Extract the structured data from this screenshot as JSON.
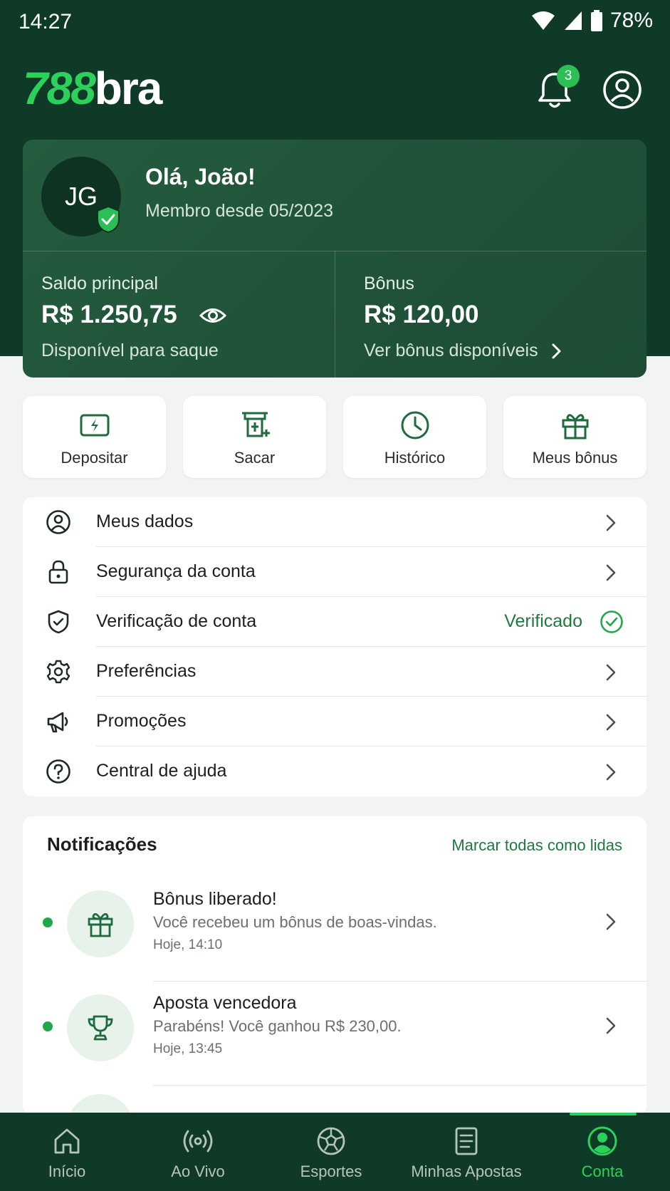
{
  "status_bar": {
    "time": "14:27",
    "battery": "78%"
  },
  "app_bar": {
    "logo_number": "788",
    "logo_text": "bra",
    "notification_count": "3"
  },
  "account": {
    "initials": "JG",
    "greeting": "Olá, João!",
    "member_since": "Membro desde 05/2023",
    "main_balance": {
      "label": "Saldo principal",
      "value": "R$ 1.250,75",
      "sub": "Disponível para saque"
    },
    "bonus_balance": {
      "label": "Bônus",
      "value": "R$ 120,00",
      "link": "Ver bônus disponíveis"
    }
  },
  "quick_actions": [
    {
      "label": "Depositar",
      "icon": "deposit-icon"
    },
    {
      "label": "Sacar",
      "icon": "withdraw-icon"
    },
    {
      "label": "Histórico",
      "icon": "clock-icon"
    },
    {
      "label": "Meus bônus",
      "icon": "gift-icon"
    }
  ],
  "menu": [
    {
      "label": "Meus dados",
      "icon": "user-circle-icon"
    },
    {
      "label": "Segurança da conta",
      "icon": "lock-icon"
    },
    {
      "label": "Verificação de conta",
      "icon": "shield-check-icon",
      "status": "Verificado"
    },
    {
      "label": "Preferências",
      "icon": "gear-icon"
    },
    {
      "label": "Promoções",
      "icon": "megaphone-icon"
    },
    {
      "label": "Central de ajuda",
      "icon": "help-icon"
    }
  ],
  "notifications": {
    "title": "Notificações",
    "mark_all": "Marcar todas como lidas",
    "items": [
      {
        "title": "Bônus liberado!",
        "desc": "Você recebeu um bônus de boas-vindas.",
        "time": "Hoje, 14:10",
        "icon": "gift-icon"
      },
      {
        "title": "Aposta vencedora",
        "desc": "Parabéns! Você ganhou R$ 230,00.",
        "time": "Hoje, 13:45",
        "icon": "trophy-icon"
      }
    ]
  },
  "bottom_nav": [
    {
      "label": "Início",
      "icon": "home-icon"
    },
    {
      "label": "Ao Vivo",
      "icon": "live-icon"
    },
    {
      "label": "Esportes",
      "icon": "soccer-ball-icon"
    },
    {
      "label": "Minhas Apostas",
      "icon": "bet-slip-icon"
    },
    {
      "label": "Conta",
      "icon": "account-icon",
      "active": true
    }
  ],
  "colors": {
    "header_bg": "#0f3a28",
    "accent": "#2bd15a",
    "verified": "#1e7b3f"
  }
}
